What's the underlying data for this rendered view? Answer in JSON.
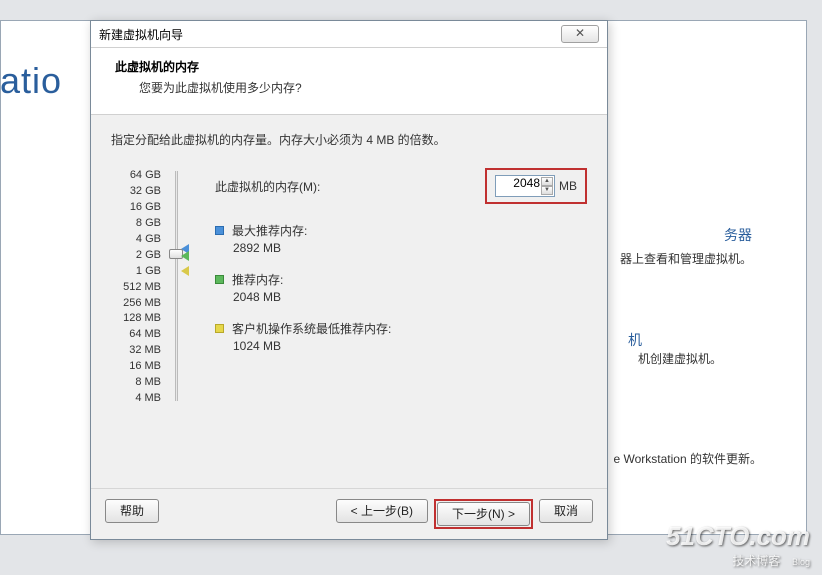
{
  "background": {
    "partial_title": "statio",
    "right_heading_1": "务器",
    "right_line_1": "器上查看和管理虚拟机。",
    "right_heading_2": "机",
    "right_line_2": "机创建虚拟机。",
    "right_line_3": "e Workstation 的软件更新。"
  },
  "dialog": {
    "title": "新建虚拟机向导",
    "header_title": "此虚拟机的内存",
    "header_subtitle": "您要为此虚拟机使用多少内存?",
    "instruction": "指定分配给此虚拟机的内存量。内存大小必须为 4 MB 的倍数。",
    "memory_label": "此虚拟机的内存(M):",
    "memory_value": "2048",
    "memory_unit": "MB",
    "slider_labels": [
      "64 GB",
      "32 GB",
      "16 GB",
      "8 GB",
      "4 GB",
      "2 GB",
      "1 GB",
      "512 MB",
      "256 MB",
      "128 MB",
      "64 MB",
      "32 MB",
      "16 MB",
      "8 MB",
      "4 MB"
    ],
    "reco": {
      "max_label": "最大推荐内存:",
      "max_value": "2892 MB",
      "rec_label": "推荐内存:",
      "rec_value": "2048 MB",
      "min_label": "客户机操作系统最低推荐内存:",
      "min_value": "1024 MB"
    },
    "buttons": {
      "help": "帮助",
      "back": "< 上一步(B)",
      "next": "下一步(N) >",
      "cancel": "取消"
    }
  },
  "watermark": {
    "line1": "51CTO.com",
    "line2": "技术博客",
    "blog": "Blog"
  }
}
